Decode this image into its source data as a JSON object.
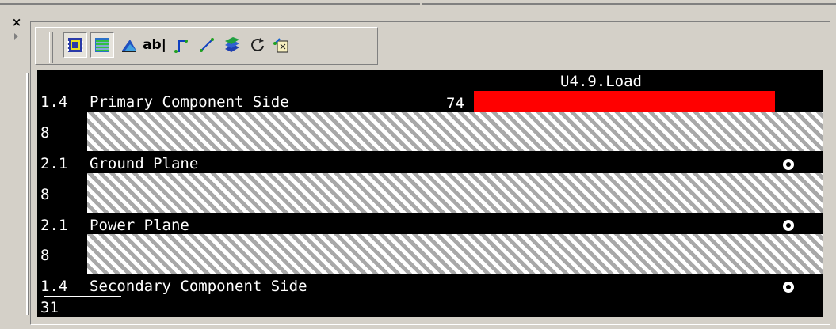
{
  "window": {
    "close_glyph": "×"
  },
  "toolbar": {
    "buttons": [
      {
        "name": "component-placement-icon",
        "pressed": true
      },
      {
        "name": "plane-layers-icon",
        "pressed": true
      },
      {
        "name": "3d-view-icon",
        "pressed": false
      },
      {
        "name": "text-label-icon",
        "pressed": false,
        "label": "ab|"
      },
      {
        "name": "trace-route-icon",
        "pressed": false
      },
      {
        "name": "diagonal-trace-icon",
        "pressed": false
      },
      {
        "name": "layer-stack-icon",
        "pressed": false
      },
      {
        "name": "refresh-icon",
        "pressed": false
      },
      {
        "name": "export-icon",
        "pressed": false
      }
    ]
  },
  "stackup": {
    "load_label": "U4.9.Load",
    "load_value": "74",
    "load_color": "#ff0000",
    "layers": [
      {
        "thickness": "1.4",
        "name": "Primary Component Side"
      },
      {
        "thickness": "2.1",
        "name": "Ground Plane"
      },
      {
        "thickness": "2.1",
        "name": "Power Plane"
      },
      {
        "thickness": "1.4",
        "name": "Secondary Component Side"
      }
    ],
    "dielectrics": [
      {
        "thickness": "8"
      },
      {
        "thickness": "8"
      },
      {
        "thickness": "8"
      }
    ],
    "total_thickness": "31"
  },
  "colors": {
    "panel_bg": "#d4d0c8",
    "stack_bg": "#000000",
    "hatch_light": "#ffffff",
    "hatch_dark": "#a8a8a8"
  }
}
